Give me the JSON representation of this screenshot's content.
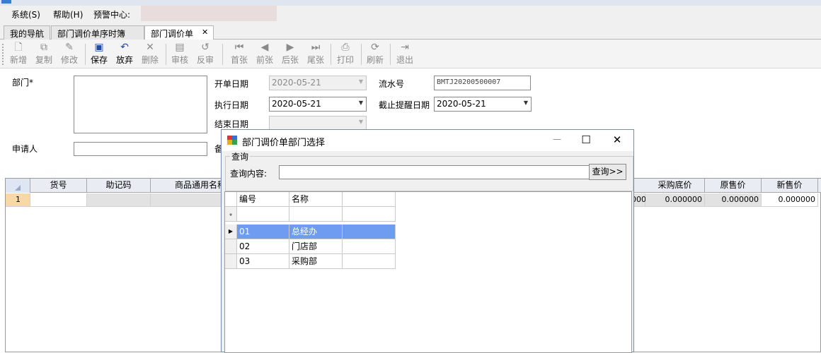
{
  "menubar": {
    "items": [
      "系统(S)",
      "帮助(H)",
      "预警中心:"
    ]
  },
  "tabs": [
    {
      "label": "我的导航"
    },
    {
      "label": "部门调价单序时簿"
    },
    {
      "label": "部门调价单",
      "close": "✕"
    }
  ],
  "toolbar": {
    "buttons": [
      {
        "label": "新增",
        "icon": "new-doc-icon"
      },
      {
        "label": "复制",
        "icon": "copy-icon"
      },
      {
        "label": "修改",
        "icon": "edit-icon"
      },
      {
        "label": "保存",
        "icon": "save-icon"
      },
      {
        "label": "放弃",
        "icon": "undo-icon"
      },
      {
        "label": "删除",
        "icon": "delete-icon"
      },
      {
        "label": "审核",
        "icon": "approve-icon"
      },
      {
        "label": "反审",
        "icon": "unapprove-icon"
      },
      {
        "label": "首张",
        "icon": "first-icon"
      },
      {
        "label": "前张",
        "icon": "prev-icon"
      },
      {
        "label": "后张",
        "icon": "next-icon"
      },
      {
        "label": "尾张",
        "icon": "last-icon"
      },
      {
        "label": "打印",
        "icon": "print-icon"
      },
      {
        "label": "刷新",
        "icon": "refresh-icon"
      },
      {
        "label": "退出",
        "icon": "exit-icon"
      }
    ]
  },
  "form": {
    "dept_label": "部门*",
    "applicant_label": "申请人",
    "remark_label": "备",
    "open_date_label": "开单日期",
    "open_date_value": "2020-05-21",
    "exec_date_label": "执行日期",
    "exec_date_value": "2020-05-21",
    "end_date_label": "结束日期",
    "end_date_value": "",
    "serial_label": "流水号",
    "serial_value": "BMTJ20200500007",
    "deadline_label": "截止提醒日期",
    "deadline_value": "2020-05-21"
  },
  "grid": {
    "columns": [
      "货号",
      "助记码",
      "商品通用名称",
      "采购底价",
      "原售价",
      "新售价"
    ],
    "row_number": "1",
    "cell_partial": "000",
    "purchase_base_price": "0.000000",
    "original_price": "0.000000",
    "new_price": "0.000000"
  },
  "dialog": {
    "title": "部门调价单部门选择",
    "minimize": "—",
    "maximize": "☐",
    "close": "✕",
    "group_label": "查询",
    "query_label": "查询内容:",
    "query_value": "",
    "query_button": "查询>>",
    "columns": [
      "编号",
      "名称"
    ],
    "rows": [
      {
        "code": "01",
        "name": "总经办"
      },
      {
        "code": "02",
        "name": "门店部"
      },
      {
        "code": "03",
        "name": "采购部"
      }
    ]
  },
  "colors": {
    "selection": "#6f9cf0",
    "dialog_border": "#6f8fb8",
    "toolbar_icon": "#1f4aa8"
  }
}
